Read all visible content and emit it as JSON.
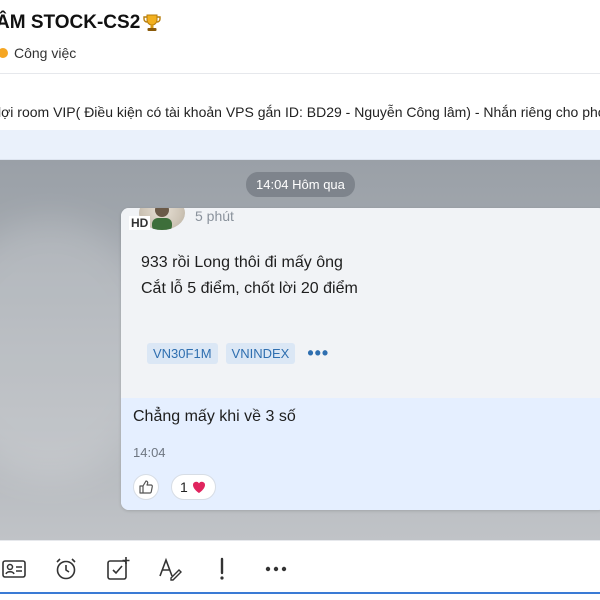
{
  "header": {
    "title": "ÂM STOCK-CS2",
    "subtitle": "Công việc"
  },
  "pinned": {
    "text": "lợi room VIP( Điều kiện có tài khoản VPS gắn ID: BD29 - Nguyễn Công lâm) - Nhắn riêng cho pho"
  },
  "chat": {
    "date_pill": "14:04 Hôm qua",
    "quoted": {
      "avatar_badge": "HD",
      "time_ago": "5 phút",
      "lines": [
        "933 rồi Long thôi đi mấy ông",
        "Cắt lỗ 5 điểm, chốt lời 20 điểm"
      ],
      "tags": [
        "VN30F1M",
        "VNINDEX"
      ],
      "more": "•••"
    },
    "reply": {
      "text": "Chẳng mấy khi về 3 số",
      "time": "14:04",
      "reaction_count": "1"
    }
  },
  "toolbar": {
    "icons": [
      "contact-card-icon",
      "alarm-clock-icon",
      "task-check-icon",
      "text-format-icon",
      "priority-icon",
      "more-icon"
    ]
  },
  "colors": {
    "accent": "#3a7bd5",
    "tag_bg": "#dbe7f5",
    "tag_text": "#2f6fb0",
    "status_dot": "#f5a623",
    "heart": "#e0245e"
  }
}
